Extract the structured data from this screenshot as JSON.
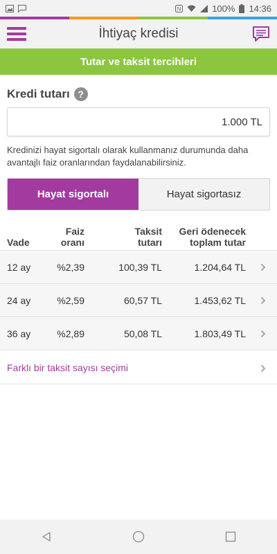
{
  "colors": {
    "accent": "#a33a9f",
    "green": "#8cc63f",
    "orange": "#f39a1f",
    "blue": "#3aa3e0"
  },
  "statusbar": {
    "icons_left": [
      "image-icon",
      "message-icon"
    ],
    "battery": "100%",
    "time": "14:36"
  },
  "appbar": {
    "title": "İhtiyaç kredisi",
    "menu_icon": "hamburger-icon",
    "chat_icon": "chat-icon"
  },
  "banner": {
    "label": "Tutar ve taksit tercihleri"
  },
  "amount": {
    "label": "Kredi tutarı",
    "help": "?",
    "value": "1.000 TL"
  },
  "info_text": "Kredinizi hayat sigortalı olarak kullanmanız durumunda daha avantajlı faiz oranlarından faydalanabilirsiniz.",
  "toggle": {
    "option_1": "Hayat sigortalı",
    "option_2": "Hayat sigortasız",
    "selected": "Hayat sigortalı"
  },
  "table": {
    "headers": {
      "vade": "Vade",
      "faiz_1": "Faiz",
      "faiz_2": "oranı",
      "taksit_1": "Taksit",
      "taksit_2": "tutarı",
      "geri_1": "Geri ödenecek",
      "geri_2": "toplam tutar"
    },
    "rows": [
      {
        "vade": "12 ay",
        "faiz": "%2,39",
        "taksit": "100,39 TL",
        "toplam": "1.204,64 TL"
      },
      {
        "vade": "24 ay",
        "faiz": "%2,59",
        "taksit": "60,57 TL",
        "toplam": "1.453,62 TL"
      },
      {
        "vade": "36 ay",
        "faiz": "%2,89",
        "taksit": "50,08 TL",
        "toplam": "1.803,49 TL"
      }
    ]
  },
  "other_option": {
    "label": "Farklı bir taksit sayısı seçimi"
  },
  "navbar": {
    "buttons": [
      "back-icon",
      "home-icon",
      "recents-icon"
    ]
  }
}
